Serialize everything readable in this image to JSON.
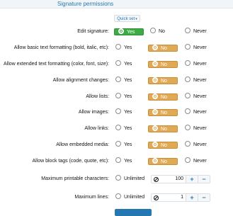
{
  "section": {
    "title": "Signature permissions"
  },
  "quick_set": {
    "label": "Quick set",
    "caret": "▾"
  },
  "options": {
    "yes": "Yes",
    "no": "No",
    "never": "Never",
    "unlimited": "Unlimited"
  },
  "rows": [
    {
      "label": "Edit signature:",
      "selected": "yes"
    },
    {
      "label": "Allow basic text formatting (bold, italic, etc):",
      "selected": "no"
    },
    {
      "label": "Allow extended text formatting (color, font, size):",
      "selected": "no"
    },
    {
      "label": "Allow alignment changes:",
      "selected": "no"
    },
    {
      "label": "Allow lists:",
      "selected": "no"
    },
    {
      "label": "Allow images:",
      "selected": "no"
    },
    {
      "label": "Allow links:",
      "selected": "no"
    },
    {
      "label": "Allow embedded media:",
      "selected": "no"
    },
    {
      "label": "Allow block tags (code, quote, etc):",
      "selected": "no"
    }
  ],
  "numeric_rows": [
    {
      "label": "Maximum printable characters:",
      "value": "100"
    },
    {
      "label": "Maximum lines:",
      "value": "1"
    }
  ],
  "stepper": {
    "plus": "+",
    "minus": "−"
  },
  "colors": {
    "accent": "#2577b1",
    "yes_selected": "#3cab45",
    "no_selected": "#e0a955"
  }
}
